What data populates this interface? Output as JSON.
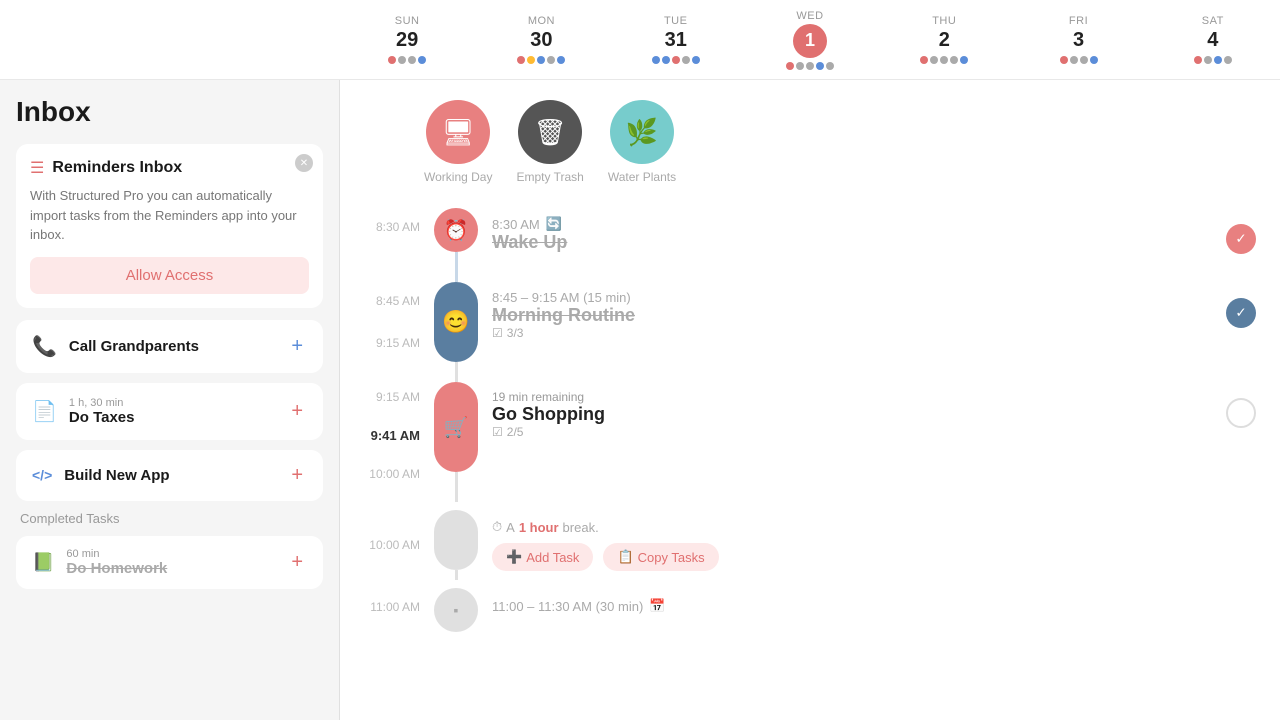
{
  "page": {
    "title": "Inbox"
  },
  "calendar": {
    "days": [
      {
        "name": "Sun",
        "num": "29",
        "today": false,
        "dots": [
          "#e07070",
          "#aaa",
          "#aaa",
          "#5b8dd9"
        ]
      },
      {
        "name": "Mon",
        "num": "30",
        "today": false,
        "dots": [
          "#e07070",
          "#ffbb33",
          "#5b8dd9",
          "#aaa",
          "#5b8dd9"
        ]
      },
      {
        "name": "Tue",
        "num": "31",
        "today": false,
        "dots": [
          "#5b8dd9",
          "#5b8dd9",
          "#e07070",
          "#aaa",
          "#5b8dd9"
        ]
      },
      {
        "name": "Wed",
        "num": "1",
        "today": true,
        "dots": [
          "#e07070",
          "#aaa",
          "#aaa",
          "#5b8dd9",
          "#aaa"
        ]
      },
      {
        "name": "Thu",
        "num": "2",
        "today": false,
        "dots": [
          "#e07070",
          "#aaa",
          "#aaa",
          "#aaa",
          "#5b8dd9"
        ]
      },
      {
        "name": "Fri",
        "num": "3",
        "today": false,
        "dots": [
          "#e07070",
          "#aaa",
          "#aaa",
          "#5b8dd9"
        ]
      },
      {
        "name": "Sat",
        "num": "4",
        "today": false,
        "dots": [
          "#e07070",
          "#aaa",
          "#5b8dd9",
          "#aaa"
        ]
      }
    ]
  },
  "reminders": {
    "card_title": "Reminders Inbox",
    "card_desc": "With Structured Pro you can automatically import tasks from the Reminders app into your inbox.",
    "allow_label": "Allow Access"
  },
  "inbox_items": [
    {
      "id": "call",
      "sub": "",
      "label": "Call Grandparents",
      "icon": "phone"
    },
    {
      "id": "taxes",
      "sub": "1 h, 30 min",
      "label": "Do Taxes",
      "icon": "doc"
    },
    {
      "id": "app",
      "sub": "",
      "label": "Build New App",
      "icon": "code"
    }
  ],
  "completed": {
    "section_title": "Completed Tasks",
    "items": [
      {
        "sub": "60 min",
        "label": "Do Homework",
        "icon": "book"
      }
    ]
  },
  "task_icons": [
    {
      "label": "Working Day",
      "icon": "🖥",
      "style": "salmon"
    },
    {
      "label": "Empty Trash",
      "icon": "🗑",
      "style": "gray"
    },
    {
      "label": "Water Plants",
      "icon": "🌿",
      "style": "green"
    }
  ],
  "timeline": {
    "wake_up": {
      "time_left": "8:30 AM",
      "time_display": "8:30 AM",
      "name": "Wake Up",
      "strikethrough": true,
      "checked": true
    },
    "morning_routine": {
      "time_left": "8:45 AM",
      "time_right": "9:15 AM",
      "time_display": "8:45 – 9:15 AM (15 min)",
      "name": "Morning Routine",
      "strikethrough": true,
      "subtask": "3/3",
      "checked": true
    },
    "go_shopping": {
      "time_left": "9:15 AM",
      "time_bold": "9:41 AM",
      "time_display": "19 min remaining",
      "name": "Go Shopping",
      "strikethrough": false,
      "subtask": "2/5",
      "checked": false
    },
    "break": {
      "time_left": "10:00 AM",
      "desc": "A",
      "duration": "1 hour",
      "suffix": "break.",
      "add_label": "Add Task",
      "copy_label": "Copy Tasks"
    },
    "next_task": {
      "time_left": "11:00 AM",
      "time_display": "11:00 – 11:30 AM (30 min)"
    }
  }
}
